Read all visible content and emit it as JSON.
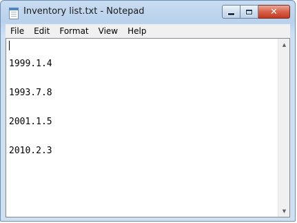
{
  "window": {
    "title": "Inventory list.txt - Notepad",
    "app_icon": "notepad-icon",
    "controls": {
      "minimize_icon": "minimize-icon",
      "maximize_icon": "maximize-icon",
      "close_icon": "close-icon",
      "close_glyph": "✕"
    }
  },
  "menu": {
    "items": [
      "File",
      "Edit",
      "Format",
      "View",
      "Help"
    ]
  },
  "editor": {
    "lines": [
      "1999.1.4",
      "1993.7.8",
      "2001.1.5",
      "2010.2.3"
    ],
    "scroll_up_glyph": "▲",
    "scroll_down_glyph": "▼"
  },
  "colors": {
    "frame": "#b9d1ec",
    "close_button": "#c23a20",
    "menubar": "#f0f0f0"
  }
}
